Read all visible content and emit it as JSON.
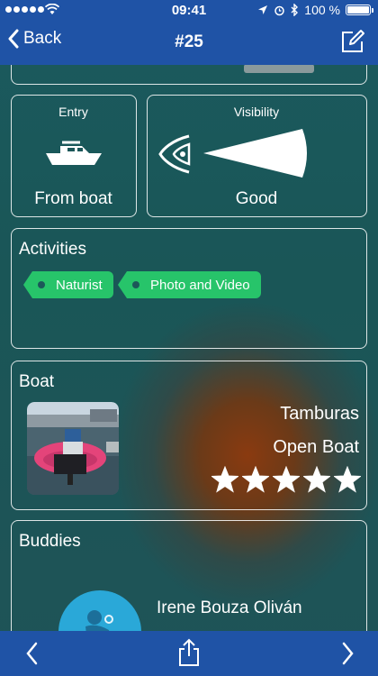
{
  "status_bar": {
    "time": "09:41",
    "battery": "100 %",
    "battery_level": 1.0
  },
  "nav": {
    "back_label": "Back",
    "title": "#25"
  },
  "entry": {
    "label": "Entry",
    "value": "From boat"
  },
  "visibility": {
    "label": "Visibility",
    "value": "Good"
  },
  "activities": {
    "title": "Activities",
    "tags": [
      "Naturist",
      "Photo and Video"
    ]
  },
  "boat": {
    "title": "Boat",
    "name": "Tamburas",
    "type": "Open Boat",
    "rating": 5,
    "rating_max": 5
  },
  "buddies": {
    "title": "Buddies",
    "items": [
      {
        "name": "Irene Bouza Oliván"
      }
    ]
  },
  "colors": {
    "bar": "#1f53a6",
    "tag": "#27c46a"
  }
}
